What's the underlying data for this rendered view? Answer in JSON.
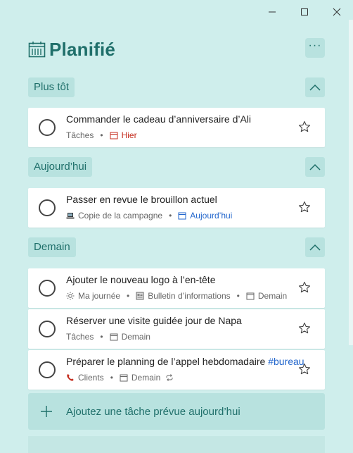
{
  "window": {
    "minimize_icon": "minimize-icon",
    "maximize_icon": "maximize-icon",
    "close_icon": "close-icon"
  },
  "header": {
    "icon": "calendar-icon",
    "title": "Planifié",
    "more_label": "···"
  },
  "sections": [
    {
      "label": "Plus tôt",
      "tasks": [
        {
          "title": "Commander le cadeau d’anniversaire d’Ali",
          "list": "Tâches",
          "due": "Hier",
          "due_style": "overdue"
        }
      ]
    },
    {
      "label": "Aujourd’hui",
      "tasks": [
        {
          "title": "Passer en revue le brouillon actuel",
          "list": "Copie de la campagne",
          "list_icon": "laptop-icon",
          "due": "Aujourd’hui",
          "due_style": "today"
        }
      ]
    },
    {
      "label": "Demain",
      "tasks": [
        {
          "title": "Ajouter le nouveau logo à l’en-tête",
          "myday": "Ma journée",
          "list": "Bulletin d’informations",
          "list_icon": "newspaper-icon",
          "due": "Demain"
        },
        {
          "title": "Réserver une visite guidée jour de Napa",
          "list": "Tâches",
          "due": "Demain"
        },
        {
          "title": "Préparer le planning de l’appel hebdomadaire ",
          "tag": "#bureau",
          "list": "Clients",
          "list_icon": "phone-icon",
          "due": "Demain",
          "repeat_icon": "repeat-icon"
        }
      ]
    }
  ],
  "add_task": {
    "label": "Ajoutez une tâche prévue aujourd’hui"
  },
  "colors": {
    "background": "#cfeeec",
    "accent": "#1f6f6a",
    "section_bg": "#b8e2df",
    "overdue": "#c42b1c",
    "today": "#2266cc"
  }
}
